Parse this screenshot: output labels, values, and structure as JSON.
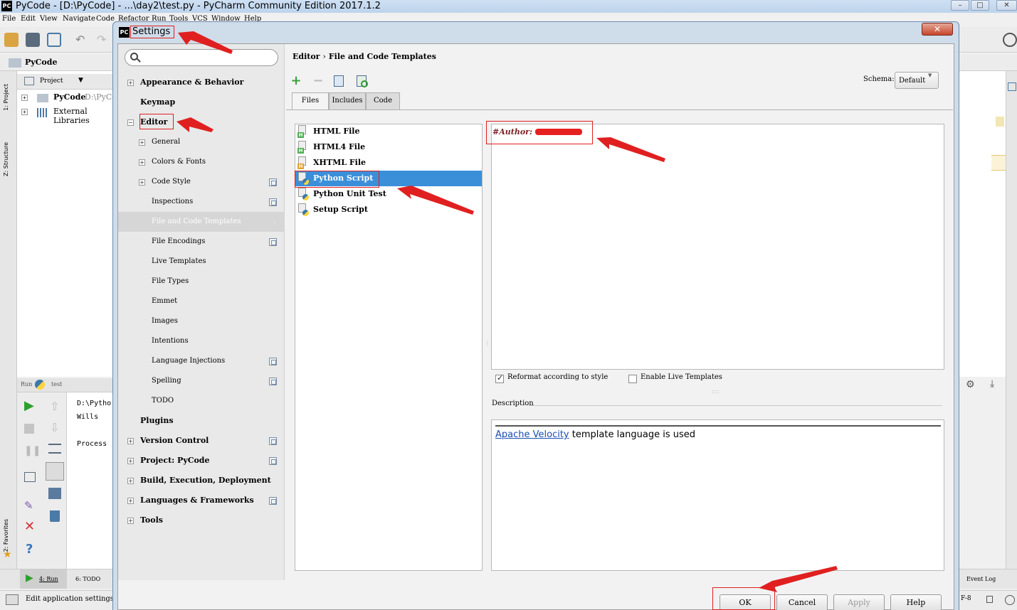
{
  "window": {
    "title": "PyCode - [D:\\PyCode] - ...\\day2\\test.py - PyCharm Community Edition 2017.1.2",
    "icon_text": "PC"
  },
  "menubar": [
    "File",
    "Edit",
    "View",
    "Navigate",
    "Code",
    "Refactor",
    "Run",
    "Tools",
    "VCS",
    "Window",
    "Help"
  ],
  "navbar": {
    "crumb": "PyCode"
  },
  "project_panel": {
    "header": "Project",
    "root_label": "PyCode",
    "root_path": "D:\\PyCo",
    "libraries": "External Libraries"
  },
  "left_strip": {
    "project": "1: Project",
    "structure": "Z: Structure",
    "favorites": "2: Favorites"
  },
  "run_panel": {
    "header_run": "Run",
    "header_config": "test",
    "console_lines": [
      "D:\\Pytho",
      "Wills",
      "",
      "Process"
    ]
  },
  "bottom_tabs": {
    "run": "4: Run",
    "todo": "6: TODO",
    "event_log": "Event Log"
  },
  "status": {
    "text": "Edit application settings",
    "encoding": "F-8"
  },
  "dialog": {
    "title": "Settings",
    "icon_text": "PC",
    "close": "✕",
    "search_placeholder": "",
    "sidebar": {
      "appearance": "Appearance & Behavior",
      "keymap": "Keymap",
      "editor": "Editor",
      "general": "General",
      "colors": "Colors & Fonts",
      "code_style": "Code Style",
      "inspections": "Inspections",
      "fct": "File and Code Templates",
      "encodings": "File Encodings",
      "live_templates": "Live Templates",
      "file_types": "File Types",
      "emmet": "Emmet",
      "images": "Images",
      "intentions": "Intentions",
      "lang_injections": "Language Injections",
      "spelling": "Spelling",
      "todo": "TODO",
      "plugins": "Plugins",
      "vcs": "Version Control",
      "project": "Project: PyCode",
      "build": "Build, Execution, Deployment",
      "languages": "Languages & Frameworks",
      "tools": "Tools"
    },
    "breadcrumb": {
      "parent": "Editor",
      "sep": "›",
      "current": "File and Code Templates"
    },
    "schema": {
      "label": "Schema:",
      "value": "Default"
    },
    "tabs": {
      "files": "Files",
      "includes": "Includes",
      "code": "Code"
    },
    "files": [
      {
        "label": "HTML File",
        "badge": "H",
        "badge_color": "#4caf50"
      },
      {
        "label": "HTML4 File",
        "badge": "H",
        "badge_color": "#4caf50"
      },
      {
        "label": "XHTML File",
        "badge": "H",
        "badge_color": "#e0a030"
      },
      {
        "label": "Python Script",
        "badge": "",
        "badge_color": ""
      },
      {
        "label": "Python Unit Test",
        "badge": "",
        "badge_color": ""
      },
      {
        "label": "Setup Script",
        "badge": "",
        "badge_color": ""
      }
    ],
    "selected_file": "Python Script",
    "template_text": "#Author: ",
    "options": {
      "reformat": "Reformat according to style",
      "reformat_checked": true,
      "live": "Enable Live Templates",
      "live_checked": false
    },
    "description": {
      "label": "Description",
      "link": "Apache Velocity",
      "text": " template language is used"
    },
    "buttons": {
      "ok": "OK",
      "cancel": "Cancel",
      "apply": "Apply",
      "help": "Help"
    }
  },
  "colors": {
    "accent": "#3b8fd9",
    "annotation": "#e02020"
  }
}
